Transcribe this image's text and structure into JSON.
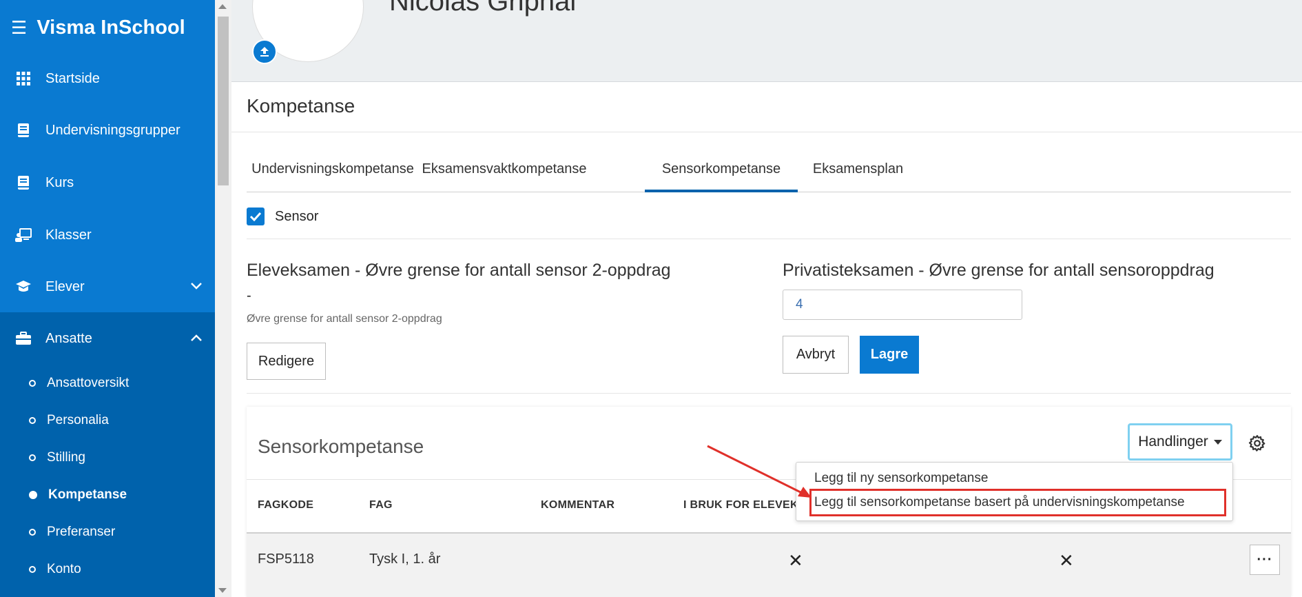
{
  "app": {
    "title": "Visma InSchool"
  },
  "sidebar": {
    "items": [
      {
        "label": "Startside",
        "icon": "grid-icon"
      },
      {
        "label": "Undervisningsgrupper",
        "icon": "book-icon"
      },
      {
        "label": "Kurs",
        "icon": "book-icon"
      },
      {
        "label": "Klasser",
        "icon": "classroom-icon"
      },
      {
        "label": "Elever",
        "icon": "graduation-cap-icon"
      },
      {
        "label": "Ansatte",
        "icon": "briefcase-icon"
      }
    ],
    "sub_items": [
      {
        "label": "Ansattoversikt"
      },
      {
        "label": "Personalia"
      },
      {
        "label": "Stilling"
      },
      {
        "label": "Kompetanse",
        "active": true
      },
      {
        "label": "Preferanser"
      },
      {
        "label": "Konto"
      }
    ]
  },
  "header": {
    "person_name": "Nicolas Griphal"
  },
  "page": {
    "section_title": "Kompetanse"
  },
  "tabs": [
    {
      "label": "Undervisningskompetanse"
    },
    {
      "label": "Eksamensvaktkompetanse"
    },
    {
      "label": "Sensorkompetanse",
      "active": true
    },
    {
      "label": "Eksamensplan"
    }
  ],
  "sensor_checkbox": {
    "label": "Sensor",
    "checked": true
  },
  "elev_limit": {
    "title": "Eleveksamen - Øvre grense for antall sensor 2-oppdrag",
    "value": "-",
    "hint": "Øvre grense for antall sensor 2-oppdrag",
    "edit_label": "Redigere"
  },
  "privatist_limit": {
    "title": "Privatisteksamen - Øvre grense for antall sensoroppdrag",
    "value": "4",
    "cancel_label": "Avbryt",
    "save_label": "Lagre"
  },
  "sensor_table": {
    "title": "Sensorkompetanse",
    "actions_label": "Handlinger",
    "columns": [
      "FAGKODE",
      "FAG",
      "KOMMENTAR",
      "I BRUK FOR ELEVEKS"
    ],
    "rows": [
      {
        "fagkode": "FSP5118",
        "fag": "Tysk I, 1. år",
        "kommentar": "",
        "mark1": "✕",
        "mark2": "✕",
        "more": "···"
      }
    ]
  },
  "actions_menu": {
    "items": [
      "Legg til ny sensorkompetanse",
      "Legg til sensorkompetanse basert på undervisningskompetanse"
    ]
  },
  "colors": {
    "brand": "#0a7ad1",
    "brand_dark": "#0062ac",
    "highlight": "#e0302a",
    "focus_ring": "#7fd0f0"
  }
}
